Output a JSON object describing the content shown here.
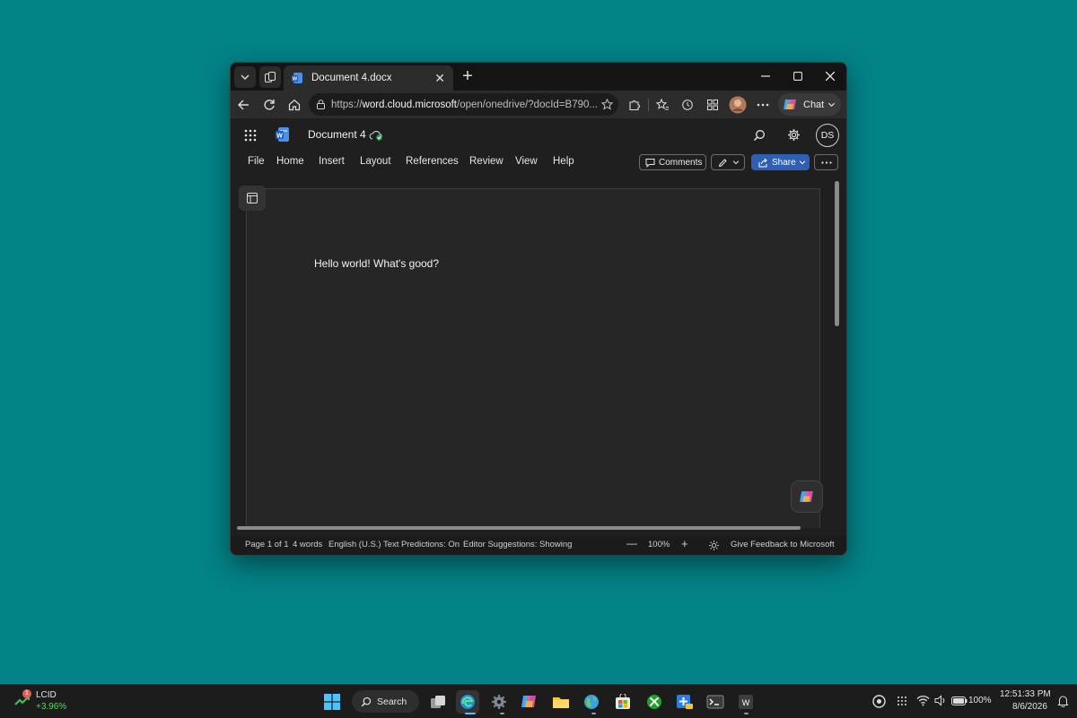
{
  "browser": {
    "tab_title": "Document 4.docx",
    "url_prefix": "https://",
    "url_host": "word.cloud.microsoft",
    "url_rest": "/open/onedrive/?docId=B790...",
    "chat_label": "Chat"
  },
  "word": {
    "doc_title": "Document 4",
    "avatar_initials": "DS",
    "menu": [
      "File",
      "Home",
      "Insert",
      "Layout",
      "References",
      "Review",
      "View",
      "Help"
    ],
    "comments_label": "Comments",
    "share_label": "Share",
    "body_text": "Hello world! What's good?"
  },
  "status": {
    "page": "Page 1 of 1",
    "words": "4 words",
    "language": "English (U.S.)",
    "text_predictions": "Text Predictions: On",
    "editor": "Editor Suggestions: Showing",
    "zoom": "100%",
    "feedback": "Give Feedback to Microsoft"
  },
  "taskbar": {
    "search_label": "Search",
    "stock_badge": "1",
    "stock_ticker": "LCID",
    "stock_change": "+3.96%",
    "battery": "100%",
    "time": "12:51:33 PM",
    "date": "8/6/2026"
  },
  "colors": {
    "desktop": "#038387",
    "share": "#2f5fb4",
    "stock_up": "#5fd068"
  }
}
